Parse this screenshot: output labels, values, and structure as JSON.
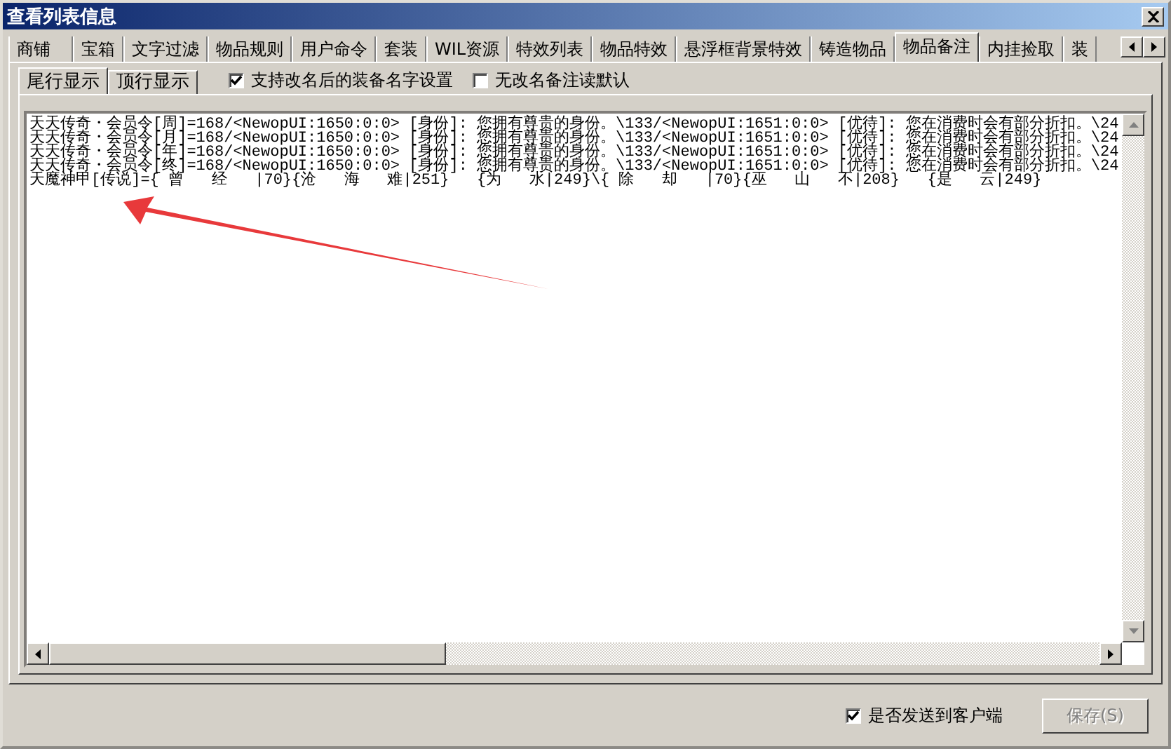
{
  "window": {
    "title": "查看列表信息"
  },
  "tabs": [
    {
      "label": "商铺",
      "selected": false
    },
    {
      "label": "宝箱",
      "selected": false
    },
    {
      "label": "文字过滤",
      "selected": false
    },
    {
      "label": "物品规则",
      "selected": false
    },
    {
      "label": "用户命令",
      "selected": false
    },
    {
      "label": "套装",
      "selected": false
    },
    {
      "label": "WIL资源",
      "selected": false
    },
    {
      "label": "特效列表",
      "selected": false
    },
    {
      "label": "物品特效",
      "selected": false
    },
    {
      "label": "悬浮框背景特效",
      "selected": false
    },
    {
      "label": "铸造物品",
      "selected": false
    },
    {
      "label": "物品备注",
      "selected": true
    },
    {
      "label": "内挂捡取",
      "selected": false
    },
    {
      "label": "装",
      "selected": false
    }
  ],
  "sub_tabs": [
    {
      "label": "尾行显示",
      "selected": true
    },
    {
      "label": "顶行显示",
      "selected": false
    }
  ],
  "options": [
    {
      "label": "支持改名后的装备名字设置",
      "checked": true
    },
    {
      "label": "无改名备注读默认",
      "checked": false
    }
  ],
  "text_lines": [
    "天天传奇・会员令[周]=168/<NewopUI:1650:0:0> [身份]: 您拥有尊贵的身份。\\133/<NewopUI:1651:0:0> [优待]: 您在消费时会有部分折扣。\\24",
    "天天传奇・会员令[月]=168/<NewopUI:1650:0:0> [身份]: 您拥有尊贵的身份。\\133/<NewopUI:1651:0:0> [优待]: 您在消费时会有部分折扣。\\24",
    "天天传奇・会员令[年]=168/<NewopUI:1650:0:0> [身份]: 您拥有尊贵的身份。\\133/<NewopUI:1651:0:0> [优待]: 您在消费时会有部分折扣。\\24",
    "天天传奇・会员令[终]=168/<NewopUI:1650:0:0> [身份]: 您拥有尊贵的身份。\\133/<NewopUI:1651:0:0> [优待]: 您在消费时会有部分折扣。\\24",
    "天魔神甲[传说]={ 曾   经   |70}{沧   海   难|251}   {为   水|249}\\{ 除   却   |70}{巫   山   不|208}   {是   云|249}"
  ],
  "send_to_client": {
    "label": "是否发送到客户端",
    "checked": true
  },
  "save_button": {
    "label": "保存(S)",
    "disabled": true
  }
}
